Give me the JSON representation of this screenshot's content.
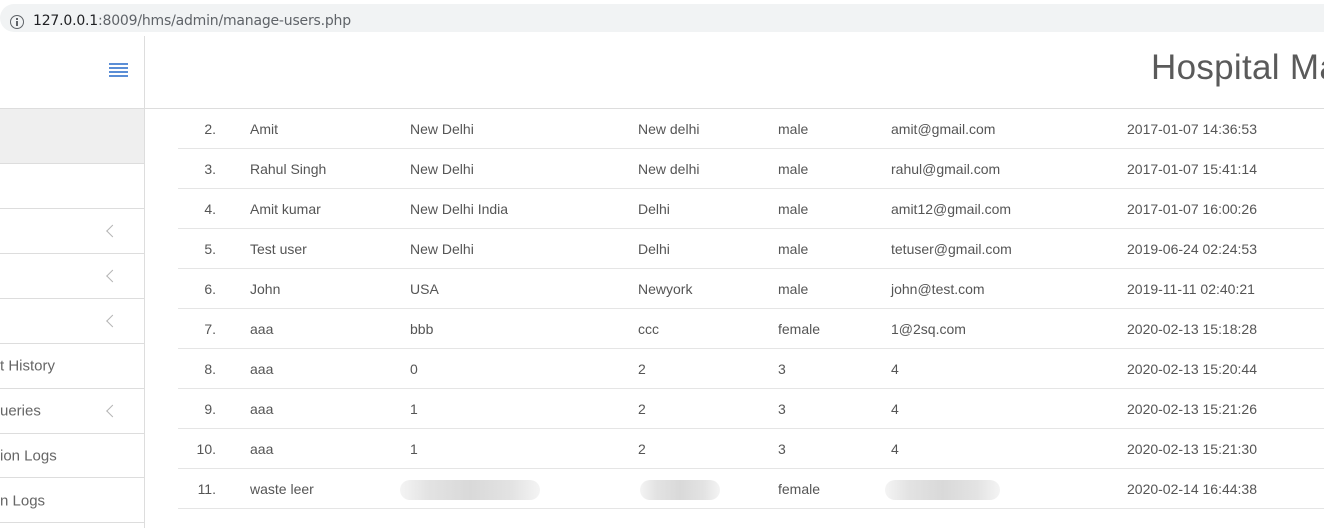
{
  "browser": {
    "url_host": "127.0.0.1",
    "url_rest": ":8009/hms/admin/manage-users.php"
  },
  "header": {
    "app_title": "Hospital Ma"
  },
  "sidebar": {
    "items": [
      {
        "label": "",
        "chevron": false
      },
      {
        "label": "",
        "chevron": false
      },
      {
        "label": "",
        "chevron": true
      },
      {
        "label": "",
        "chevron": true
      },
      {
        "label": "",
        "chevron": true
      },
      {
        "label": "t History",
        "chevron": false
      },
      {
        "label": "ueries",
        "chevron": true
      },
      {
        "label": "ion Logs",
        "chevron": false
      },
      {
        "label": "n Logs",
        "chevron": false
      }
    ]
  },
  "users_table": {
    "rows": [
      {
        "num": "2.",
        "name": "Amit",
        "address": "New Delhi",
        "city": "New delhi",
        "gender": "male",
        "email": "amit@gmail.com",
        "created": "2017-01-07 14:36:53"
      },
      {
        "num": "3.",
        "name": "Rahul Singh",
        "address": "New Delhi",
        "city": "New delhi",
        "gender": "male",
        "email": "rahul@gmail.com",
        "created": "2017-01-07 15:41:14"
      },
      {
        "num": "4.",
        "name": "Amit kumar",
        "address": "New Delhi India",
        "city": "Delhi",
        "gender": "male",
        "email": "amit12@gmail.com",
        "created": "2017-01-07 16:00:26"
      },
      {
        "num": "5.",
        "name": "Test user",
        "address": "New Delhi",
        "city": "Delhi",
        "gender": "male",
        "email": "tetuser@gmail.com",
        "created": "2019-06-24 02:24:53"
      },
      {
        "num": "6.",
        "name": "John",
        "address": "USA",
        "city": "Newyork",
        "gender": "male",
        "email": "john@test.com",
        "created": "2019-11-11 02:40:21"
      },
      {
        "num": "7.",
        "name": "aaa",
        "address": "bbb",
        "city": "ccc",
        "gender": "female",
        "email": "1@2sq.com",
        "created": "2020-02-13 15:18:28"
      },
      {
        "num": "8.",
        "name": "aaa",
        "address": "0",
        "city": "2",
        "gender": "3",
        "email": "4",
        "created": "2020-02-13 15:20:44"
      },
      {
        "num": "9.",
        "name": "aaa",
        "address": "1",
        "city": "2",
        "gender": "3",
        "email": "4",
        "created": "2020-02-13 15:21:26"
      },
      {
        "num": "10.",
        "name": "aaa",
        "address": "1",
        "city": "2",
        "gender": "3",
        "email": "4",
        "created": "2020-02-13 15:21:30"
      },
      {
        "num": "11.",
        "name": "waste leer",
        "address": "",
        "city": "",
        "gender": "female",
        "email": "",
        "created": "2020-02-14 16:44:38"
      }
    ]
  }
}
